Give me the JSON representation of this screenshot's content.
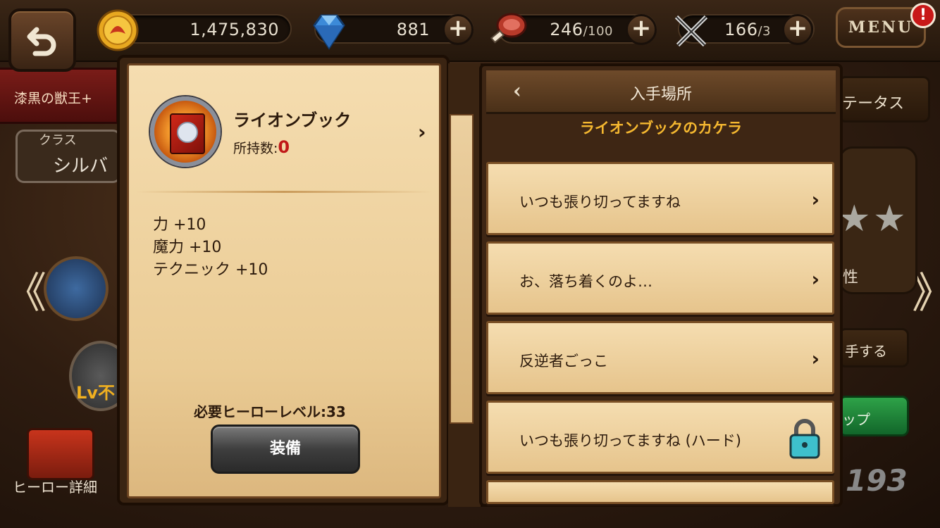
{
  "top_bar": {
    "gold": "1,475,830",
    "gems": "881",
    "stamina_current": "246",
    "stamina_max": "/100",
    "battle_current": "166",
    "battle_max": "/3",
    "menu_label": "MENU",
    "alert_label": "!",
    "plus_label": "+"
  },
  "background": {
    "hero_name": "漆黒の獣王+",
    "class_label": "クラス",
    "class_value": "シルバ",
    "status_tab": "テータス",
    "attribute_label": "性",
    "get_label": "手する",
    "levelup_label": "ップ",
    "level_lock": "Lv不",
    "power_value": "193",
    "hero_detail_label": "ヒーロー詳細",
    "prev_arrow": "《",
    "next_arrow": "》"
  },
  "item": {
    "name": "ライオンブック",
    "owned_label": "所持数:",
    "owned_value": "0",
    "detail_chevron": "›",
    "stats": [
      "力 +10",
      "魔力 +10",
      "テクニック +10"
    ],
    "required_level": "必要ヒーローレベル:33",
    "equip_label": "装備"
  },
  "sources": {
    "back_label": "‹",
    "title": "入手場所",
    "subtitle": "ライオンブックのカケラ",
    "rows": [
      {
        "label": "いつも張り切ってますね",
        "locked": false
      },
      {
        "label": "お、落ち着くのよ…",
        "locked": false
      },
      {
        "label": "反逆者ごっこ",
        "locked": false
      },
      {
        "label": "いつも張り切ってますね (ハード)",
        "locked": true
      }
    ],
    "row_chevron": "›"
  },
  "colors": {
    "accent_orange": "#f5b830",
    "owned_red": "#c01818",
    "equip_green": "#2ea248"
  },
  "icons": [
    "back-arrow-icon",
    "gold-coin-icon",
    "diamond-gem-icon",
    "meat-stamina-icon",
    "crossed-swords-icon",
    "lock-icon",
    "lion-book-icon"
  ]
}
